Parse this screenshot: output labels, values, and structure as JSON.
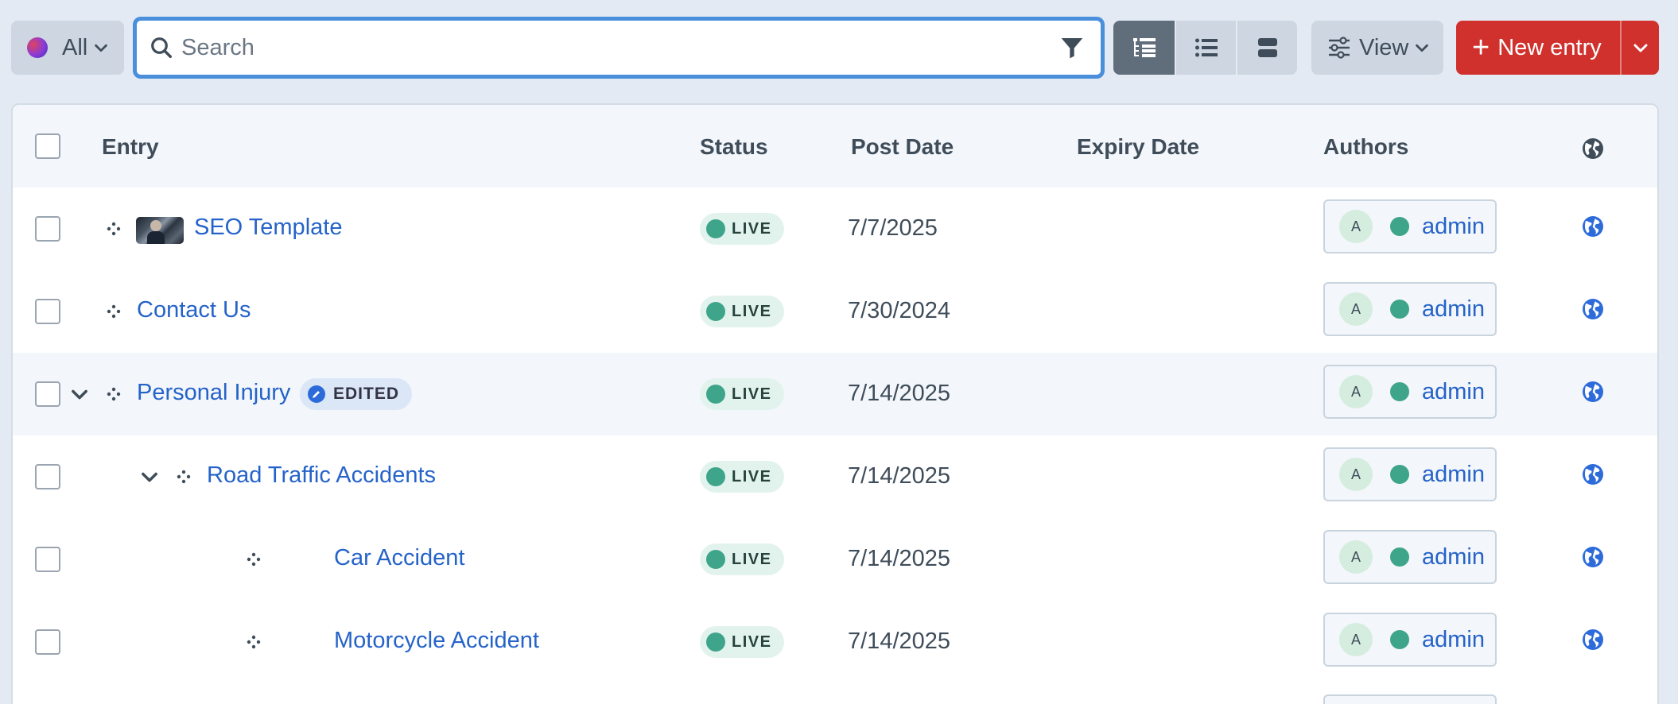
{
  "toolbar": {
    "site_label": "All",
    "search_placeholder": "Search",
    "view_label": "View",
    "new_entry_label": "New entry",
    "new_entry_plus": "+"
  },
  "table": {
    "headers": {
      "entry": "Entry",
      "status": "Status",
      "post_date": "Post Date",
      "expiry_date": "Expiry Date",
      "authors": "Authors"
    },
    "rows": [
      {
        "title": "SEO Template",
        "status": "LIVE",
        "post_date": "7/7/2025",
        "expiry_date": "",
        "author_initial": "A",
        "author": "admin"
      },
      {
        "title": "Contact Us",
        "status": "LIVE",
        "post_date": "7/30/2024",
        "expiry_date": "",
        "author_initial": "A",
        "author": "admin"
      },
      {
        "title": "Personal Injury",
        "badge": "EDITED",
        "status": "LIVE",
        "post_date": "7/14/2025",
        "expiry_date": "",
        "author_initial": "A",
        "author": "admin"
      },
      {
        "title": "Road Traffic Accidents",
        "status": "LIVE",
        "post_date": "7/14/2025",
        "expiry_date": "",
        "author_initial": "A",
        "author": "admin"
      },
      {
        "title": "Car Accident",
        "status": "LIVE",
        "post_date": "7/14/2025",
        "expiry_date": "",
        "author_initial": "A",
        "author": "admin"
      },
      {
        "title": "Motorcycle Accident",
        "status": "LIVE",
        "post_date": "7/14/2025",
        "expiry_date": "",
        "author_initial": "A",
        "author": "admin"
      }
    ]
  },
  "colors": {
    "accent_blue": "#2563c9",
    "danger_red": "#d0312d",
    "live_green": "#3fa58a"
  },
  "icons": [
    "site-gradient-icon",
    "search-icon",
    "filter-icon",
    "structure-view-icon",
    "list-view-icon",
    "card-view-icon",
    "sliders-icon",
    "chevron-down-icon",
    "move-handle-icon",
    "pencil-icon",
    "globe-icon"
  ]
}
